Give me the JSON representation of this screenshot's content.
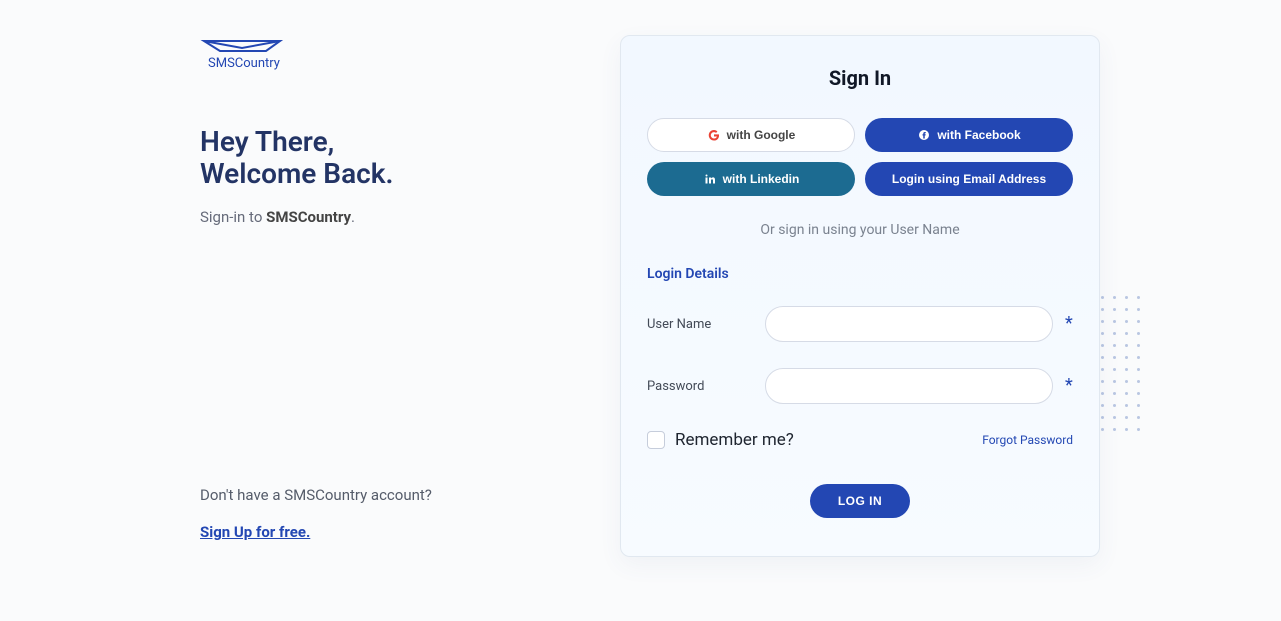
{
  "brand": {
    "name": "SMSCountry"
  },
  "left": {
    "welcome_line1": "Hey There,",
    "welcome_line2": "Welcome Back.",
    "signin_prefix": "Sign-in to ",
    "signin_brand": "SMSCountry",
    "signin_suffix": ".",
    "no_account": "Don't have a SMSCountry account?",
    "signup": "Sign Up for free."
  },
  "card": {
    "title": "Sign In",
    "buttons": {
      "google": "with Google",
      "facebook": "with Facebook",
      "linkedin": "with Linkedin",
      "email": "Login using Email Address"
    },
    "or_text": "Or sign in using your User Name",
    "section": "Login Details",
    "fields": {
      "username_label": "User Name",
      "username_value": "",
      "password_label": "Password",
      "password_value": "",
      "asterisk": "*"
    },
    "remember": "Remember me?",
    "forgot": "Forgot Password",
    "login": "LOG IN"
  },
  "colors": {
    "primary": "#2347b3",
    "linkedin": "#1c6b91"
  }
}
